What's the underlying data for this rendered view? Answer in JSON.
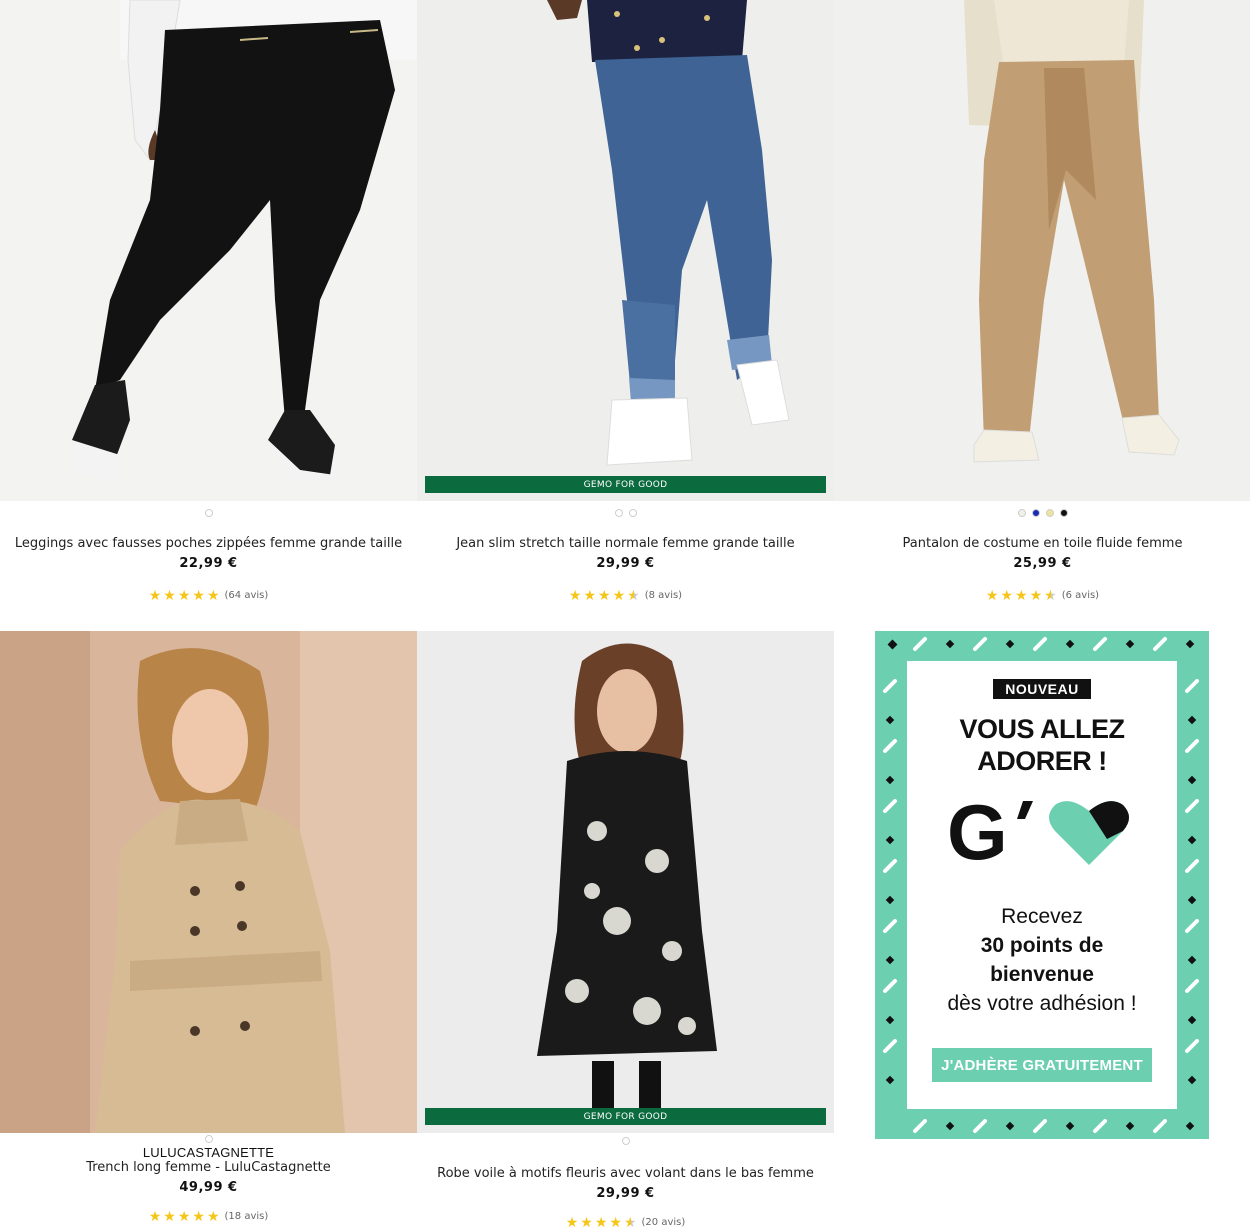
{
  "products": [
    {
      "brand": "",
      "title": "Leggings avec fausses poches zippées femme grande taille",
      "price": "22,99 €",
      "rating": 5,
      "reviews": "(64 avis)",
      "badge": "",
      "swatch_colors": [
        "#ffffff"
      ]
    },
    {
      "brand": "",
      "title": "Jean slim stretch taille normale femme grande taille",
      "price": "29,99 €",
      "rating": 4.5,
      "reviews": "(8 avis)",
      "badge": "GEMO FOR GOOD",
      "swatch_colors": [
        "#ffffff",
        "#ffffff"
      ]
    },
    {
      "brand": "",
      "title": "Pantalon de costume en toile fluide femme",
      "price": "25,99 €",
      "rating": 4.5,
      "reviews": "(6 avis)",
      "badge": "",
      "swatch_colors": [
        "#f0efe8",
        "#1a2bb5",
        "#efe39a",
        "#111111"
      ]
    },
    {
      "brand": "LULUCASTAGNETTE",
      "title": "Trench long femme - LuluCastagnette",
      "price": "49,99 €",
      "rating": 5,
      "reviews": "(18 avis)",
      "badge": "",
      "swatch_colors": [
        "#ffffff"
      ]
    },
    {
      "brand": "",
      "title": "Robe voile à motifs fleuris avec volant dans le bas femme",
      "price": "29,99 €",
      "rating": 4.5,
      "reviews": "(20 avis)",
      "badge": "GEMO FOR GOOD",
      "swatch_colors": [
        "#ffffff"
      ]
    }
  ],
  "promo": {
    "badge": "NOUVEAU",
    "headline_1": "VOUS ALLEZ",
    "headline_2": "ADORER !",
    "logo_letter": "G",
    "line_1": "Recevez",
    "line_2": "30 points de",
    "line_3": "bienvenue",
    "line_4": "dès votre adhésion !",
    "cta": "J'ADHÈRE GRATUITEMENT",
    "accent_color": "#6ccfb0"
  },
  "colors": {
    "gfg_badge": "#0b6b3e",
    "star": "#f5c518"
  }
}
